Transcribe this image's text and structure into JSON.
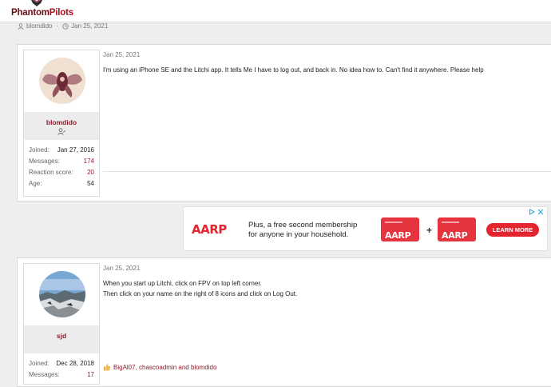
{
  "site": {
    "logo_part1": "Phantom",
    "logo_part2": "Pilots"
  },
  "thread": {
    "author": "blomdido",
    "date": "Jan 25, 2021"
  },
  "posts": [
    {
      "username": "blomdido",
      "date": "Jan 25, 2021",
      "stats": [
        {
          "label": "Joined:",
          "value": "Jan 27, 2016"
        },
        {
          "label": "Messages:",
          "value": "174"
        },
        {
          "label": "Reaction score:",
          "value": "20"
        },
        {
          "label": "Age:",
          "value": "54"
        }
      ],
      "body": [
        "I'm using an iPhone SE and the Litchi app. It tells Me I have to log out, and back in. No idea how to. Can't find it anywhere. Please help"
      ]
    },
    {
      "username": "sjd",
      "date": "Jan 25, 2021",
      "stats": [
        {
          "label": "Joined:",
          "value": "Dec 28, 2018"
        },
        {
          "label": "Messages:",
          "value": "17"
        }
      ],
      "body": [
        "When you start up Litchi, click on FPV on top left corner.",
        "Then click on your name on the right of 8 icons and click on Log Out."
      ],
      "likes": "BigAl07, chascoadmin and blomdido"
    }
  ],
  "ad": {
    "brand": "AARP",
    "headline_line1": "Plus, a free second membership",
    "headline_line2": "for anyone in your household.",
    "plus": "+",
    "cta": "LEARN MORE"
  },
  "colors": {
    "brand": "#8d1b2a",
    "ad_red": "#e4242f"
  }
}
